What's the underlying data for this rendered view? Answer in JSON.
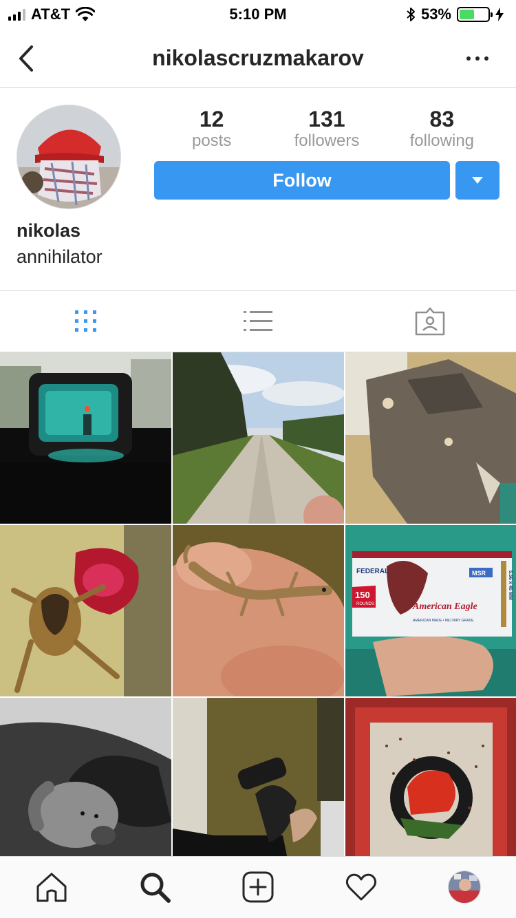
{
  "status_bar": {
    "carrier": "AT&T",
    "time": "5:10 PM",
    "battery_percent": "53%",
    "battery_level": 0.53,
    "battery_color": "#4cd964"
  },
  "nav": {
    "username": "nikolascruzmakarov",
    "back_icon": "chevron-left-icon",
    "more_icon": "more-horizontal-icon"
  },
  "profile": {
    "stats": [
      {
        "value": "12",
        "label": "posts"
      },
      {
        "value": "131",
        "label": "followers"
      },
      {
        "value": "83",
        "label": "following"
      }
    ],
    "follow_label": "Follow",
    "name": "nikolas",
    "bio": "annihilator",
    "accent_color": "#3897f0"
  },
  "view_tabs": [
    {
      "name": "grid-view",
      "icon": "grid-icon",
      "active": true
    },
    {
      "name": "list-view",
      "icon": "list-icon",
      "active": false
    },
    {
      "name": "tagged-view",
      "icon": "tagged-user-icon",
      "active": false
    }
  ],
  "posts": {
    "box_text": {
      "brand": "FEDERAL",
      "count": "150",
      "count_unit": "ROUNDS",
      "product": "American Eagle",
      "badge": "MSR",
      "caliber": "5.56 x 45 MM",
      "tagline": "AMERICAN MADE • MILITARY GRADE"
    }
  },
  "tab_bar": [
    {
      "name": "home",
      "icon": "home-icon"
    },
    {
      "name": "search",
      "icon": "search-icon"
    },
    {
      "name": "new-post",
      "icon": "plus-square-icon"
    },
    {
      "name": "activity",
      "icon": "heart-icon"
    },
    {
      "name": "profile",
      "icon": "profile-avatar-icon"
    }
  ]
}
